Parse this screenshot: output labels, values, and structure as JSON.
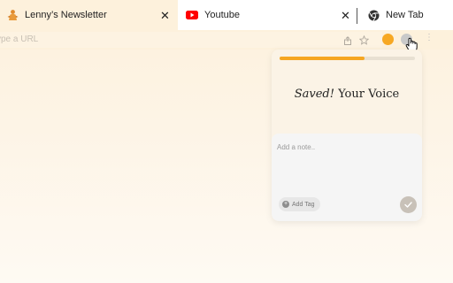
{
  "tabs": [
    {
      "label": "Lenny’s Newsletter",
      "close": "✕",
      "icon": "lenny-favicon"
    },
    {
      "label": "Youtube",
      "close": "✕",
      "icon": "youtube-icon"
    },
    {
      "label": "New Tab",
      "icon": "chrome-icon"
    }
  ],
  "omnibox": {
    "placeholder": "ype a URL"
  },
  "toolbar": {
    "menu": "⋮"
  },
  "popup": {
    "progress_percent": 63,
    "title_italic": "Saved!",
    "title_rest": " Your Voice",
    "note_placeholder": "Add a note..",
    "add_tag_label": "Add Tag",
    "add_tag_icon": "+"
  },
  "colors": {
    "accent": "#f5a623",
    "youtube": "#ff0000"
  }
}
